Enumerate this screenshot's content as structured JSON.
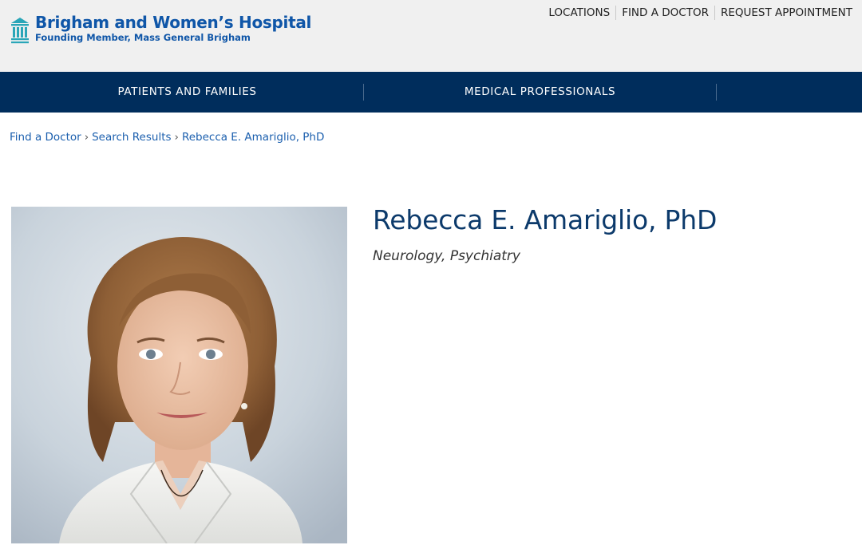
{
  "brand": {
    "name": "Brigham and Women’s Hospital",
    "subtitle": "Founding Member, Mass General Brigham",
    "color": "#0f56a8",
    "icon": "hospital-columns-logo"
  },
  "utility_nav": [
    "LOCATIONS",
    "FIND A DOCTOR",
    "REQUEST APPOINTMENT"
  ],
  "main_nav": {
    "background": "#002d5c",
    "items": [
      "PATIENTS AND FAMILIES",
      "MEDICAL PROFESSIONALS"
    ]
  },
  "breadcrumb": {
    "items": [
      "Find a Doctor",
      "Search Results",
      "Rebecca E. Amariglio, PhD"
    ],
    "separator": "›"
  },
  "profile": {
    "name": "Rebecca E. Amariglio, PhD",
    "specialties": [
      "Neurology",
      "Psychiatry"
    ],
    "specialty_separator": ",",
    "photo_alt": "headshot-photo"
  }
}
